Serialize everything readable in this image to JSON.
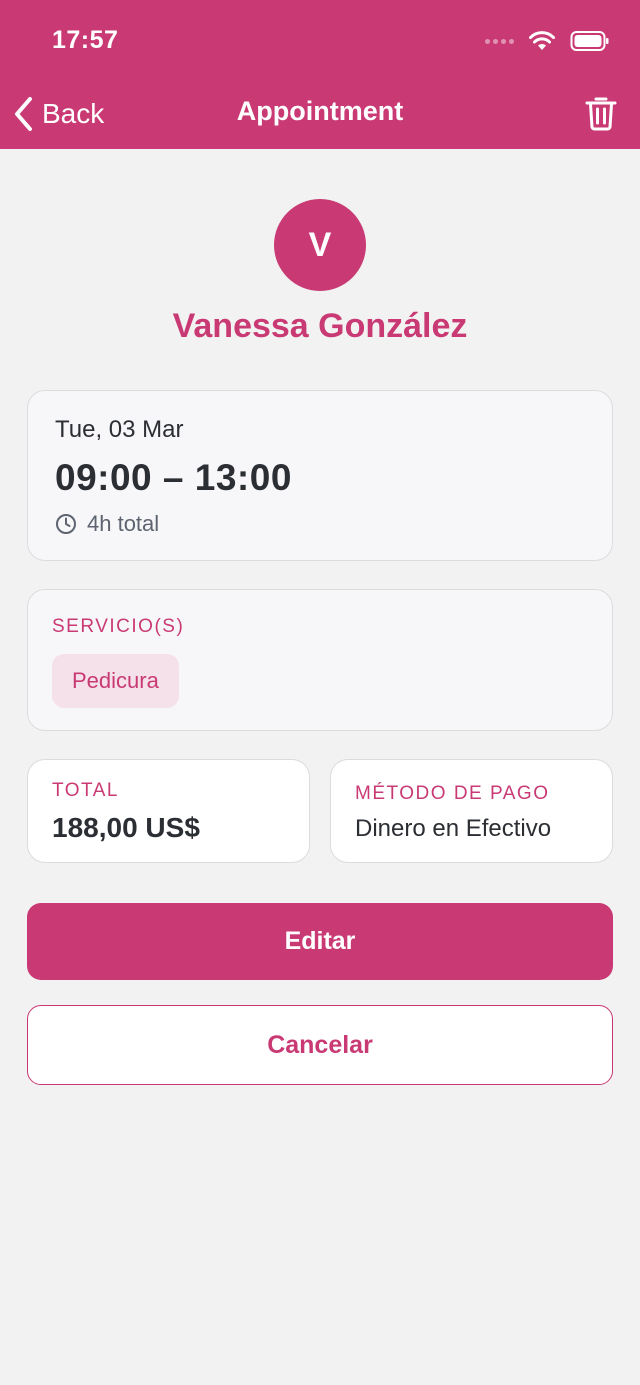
{
  "status_bar": {
    "time": "17:57"
  },
  "nav": {
    "back_label": "Back",
    "title": "Appointment"
  },
  "client": {
    "initial": "V",
    "name": "Vanessa González"
  },
  "appointment": {
    "date": "Tue, 03 Mar",
    "time_range": "09:00 – 13:00",
    "duration": "4h total"
  },
  "services": {
    "label": "SERVICIO(S)",
    "items": [
      "Pedicura"
    ]
  },
  "total": {
    "label": "TOTAL",
    "amount": "188,00 US$"
  },
  "payment": {
    "label": "MÉTODO DE PAGO",
    "method": "Dinero en Efectivo"
  },
  "actions": {
    "edit_label": "Editar",
    "cancel_label": "Cancelar"
  },
  "colors": {
    "accent": "#c93a74",
    "background": "#f2f2f2",
    "chip_bg": "#f5e1ea"
  },
  "icons": [
    "chevron-left-icon",
    "trash-icon",
    "clock-icon",
    "wifi-icon",
    "battery-icon",
    "signal-icon"
  ]
}
